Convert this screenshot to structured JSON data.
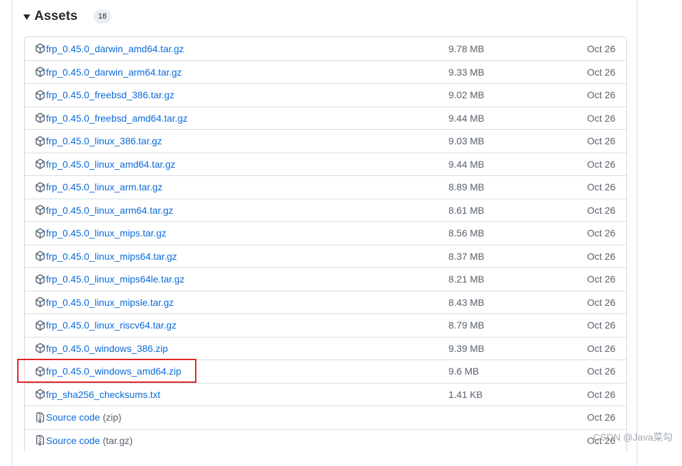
{
  "assets": {
    "title": "Assets",
    "count": "18",
    "items": [
      {
        "name": "frp_0.45.0_darwin_amd64.tar.gz",
        "size": "9.78 MB",
        "date": "Oct 26",
        "icon": "package-icon"
      },
      {
        "name": "frp_0.45.0_darwin_arm64.tar.gz",
        "size": "9.33 MB",
        "date": "Oct 26",
        "icon": "package-icon"
      },
      {
        "name": "frp_0.45.0_freebsd_386.tar.gz",
        "size": "9.02 MB",
        "date": "Oct 26",
        "icon": "package-icon"
      },
      {
        "name": "frp_0.45.0_freebsd_amd64.tar.gz",
        "size": "9.44 MB",
        "date": "Oct 26",
        "icon": "package-icon"
      },
      {
        "name": "frp_0.45.0_linux_386.tar.gz",
        "size": "9.03 MB",
        "date": "Oct 26",
        "icon": "package-icon"
      },
      {
        "name": "frp_0.45.0_linux_amd64.tar.gz",
        "size": "9.44 MB",
        "date": "Oct 26",
        "icon": "package-icon"
      },
      {
        "name": "frp_0.45.0_linux_arm.tar.gz",
        "size": "8.89 MB",
        "date": "Oct 26",
        "icon": "package-icon"
      },
      {
        "name": "frp_0.45.0_linux_arm64.tar.gz",
        "size": "8.61 MB",
        "date": "Oct 26",
        "icon": "package-icon"
      },
      {
        "name": "frp_0.45.0_linux_mips.tar.gz",
        "size": "8.56 MB",
        "date": "Oct 26",
        "icon": "package-icon"
      },
      {
        "name": "frp_0.45.0_linux_mips64.tar.gz",
        "size": "8.37 MB",
        "date": "Oct 26",
        "icon": "package-icon"
      },
      {
        "name": "frp_0.45.0_linux_mips64le.tar.gz",
        "size": "8.21 MB",
        "date": "Oct 26",
        "icon": "package-icon"
      },
      {
        "name": "frp_0.45.0_linux_mipsle.tar.gz",
        "size": "8.43 MB",
        "date": "Oct 26",
        "icon": "package-icon"
      },
      {
        "name": "frp_0.45.0_linux_riscv64.tar.gz",
        "size": "8.79 MB",
        "date": "Oct 26",
        "icon": "package-icon"
      },
      {
        "name": "frp_0.45.0_windows_386.zip",
        "size": "9.39 MB",
        "date": "Oct 26",
        "icon": "package-icon"
      },
      {
        "name": "frp_0.45.0_windows_amd64.zip",
        "size": "9.6 MB",
        "date": "Oct 26",
        "icon": "package-icon",
        "highlighted": true
      },
      {
        "name": "frp_sha256_checksums.txt",
        "size": "1.41 KB",
        "date": "Oct 26",
        "icon": "package-icon"
      },
      {
        "name": "Source code",
        "suffix": "(zip)",
        "size": "",
        "date": "Oct 26",
        "icon": "file-zip-icon"
      },
      {
        "name": "Source code",
        "suffix": "(tar.gz)",
        "size": "",
        "date": "Oct 26",
        "icon": "file-zip-icon"
      }
    ]
  },
  "highlight_color": "#e02424",
  "link_color": "#0969da",
  "watermark": "CSDN @Java菜勾"
}
